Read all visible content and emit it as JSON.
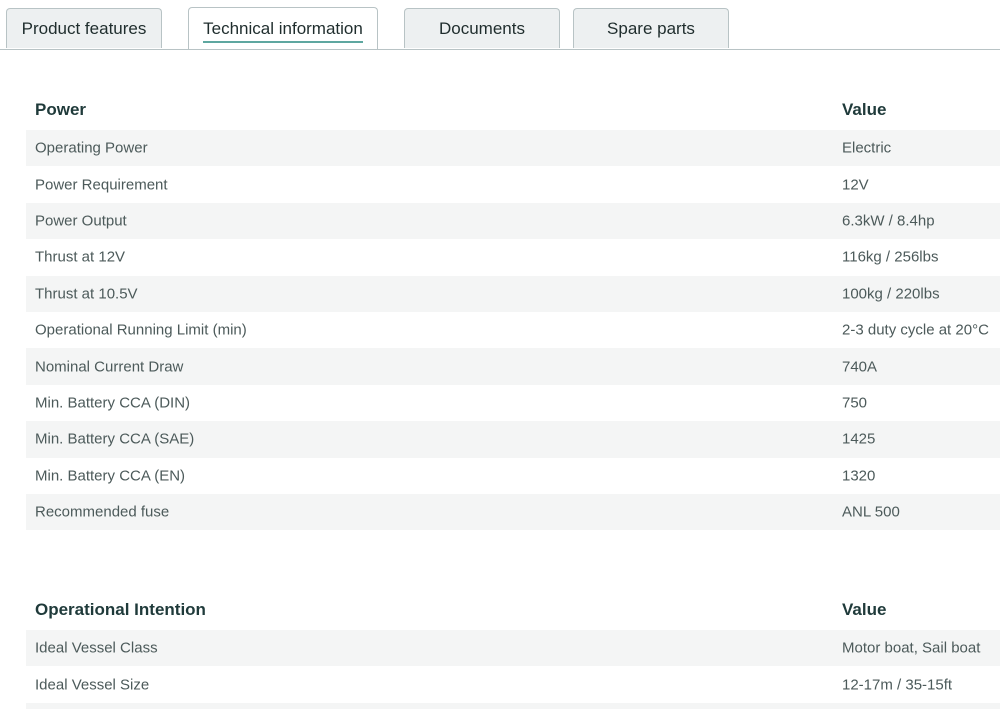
{
  "tabs": [
    {
      "label": "Product features"
    },
    {
      "label": "Technical information"
    },
    {
      "label": "Documents"
    },
    {
      "label": "Spare parts"
    }
  ],
  "power_table": {
    "header": {
      "name": "Power",
      "value": "Value"
    },
    "rows": [
      {
        "name": "Operating Power",
        "value": "Electric"
      },
      {
        "name": "Power Requirement",
        "value": "12V"
      },
      {
        "name": "Power Output",
        "value": "6.3kW / 8.4hp"
      },
      {
        "name": "Thrust at 12V",
        "value": "116kg / 256lbs"
      },
      {
        "name": "Thrust at 10.5V",
        "value": "100kg / 220lbs"
      },
      {
        "name": "Operational Running Limit (min)",
        "value": "2-3 duty cycle at 20°C"
      },
      {
        "name": "Nominal Current Draw",
        "value": "740A"
      },
      {
        "name": "Min. Battery CCA (DIN)",
        "value": "750"
      },
      {
        "name": "Min. Battery CCA (SAE)",
        "value": "1425"
      },
      {
        "name": "Min. Battery CCA (EN)",
        "value": "1320"
      },
      {
        "name": "Recommended fuse",
        "value": "ANL 500"
      }
    ]
  },
  "operational_table": {
    "header": {
      "name": "Operational Intention",
      "value": "Value"
    },
    "rows": [
      {
        "name": "Ideal Vessel Class",
        "value": "Motor boat, Sail boat"
      },
      {
        "name": "Ideal Vessel Size",
        "value": "12-17m / 35-15ft"
      }
    ]
  }
}
